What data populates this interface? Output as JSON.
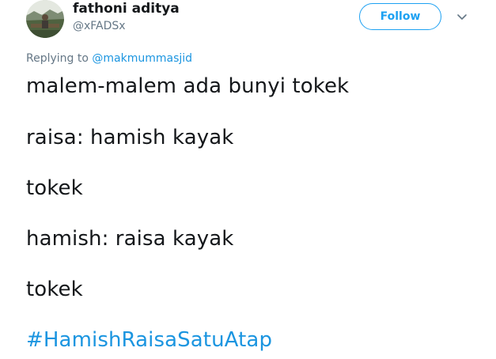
{
  "author": {
    "display_name": "fathoni aditya",
    "handle": "@xFADSx",
    "avatar_icon": "profile-photo"
  },
  "actions": {
    "follow_label": "Follow",
    "menu_icon": "chevron-down-icon"
  },
  "reply": {
    "prefix": "Replying to ",
    "mention": "@makmummasjid"
  },
  "tweet": {
    "lines": [
      "malem-malem ada bunyi tokek",
      "raisa: hamish kayak",
      "tokek",
      "hamish: raisa kayak",
      "tokek"
    ],
    "hashtag": "#HamishRaisaSatuAtap"
  },
  "colors": {
    "accent": "#1da1f2",
    "link": "#1b95e0",
    "text": "#14171a",
    "muted": "#657786"
  }
}
